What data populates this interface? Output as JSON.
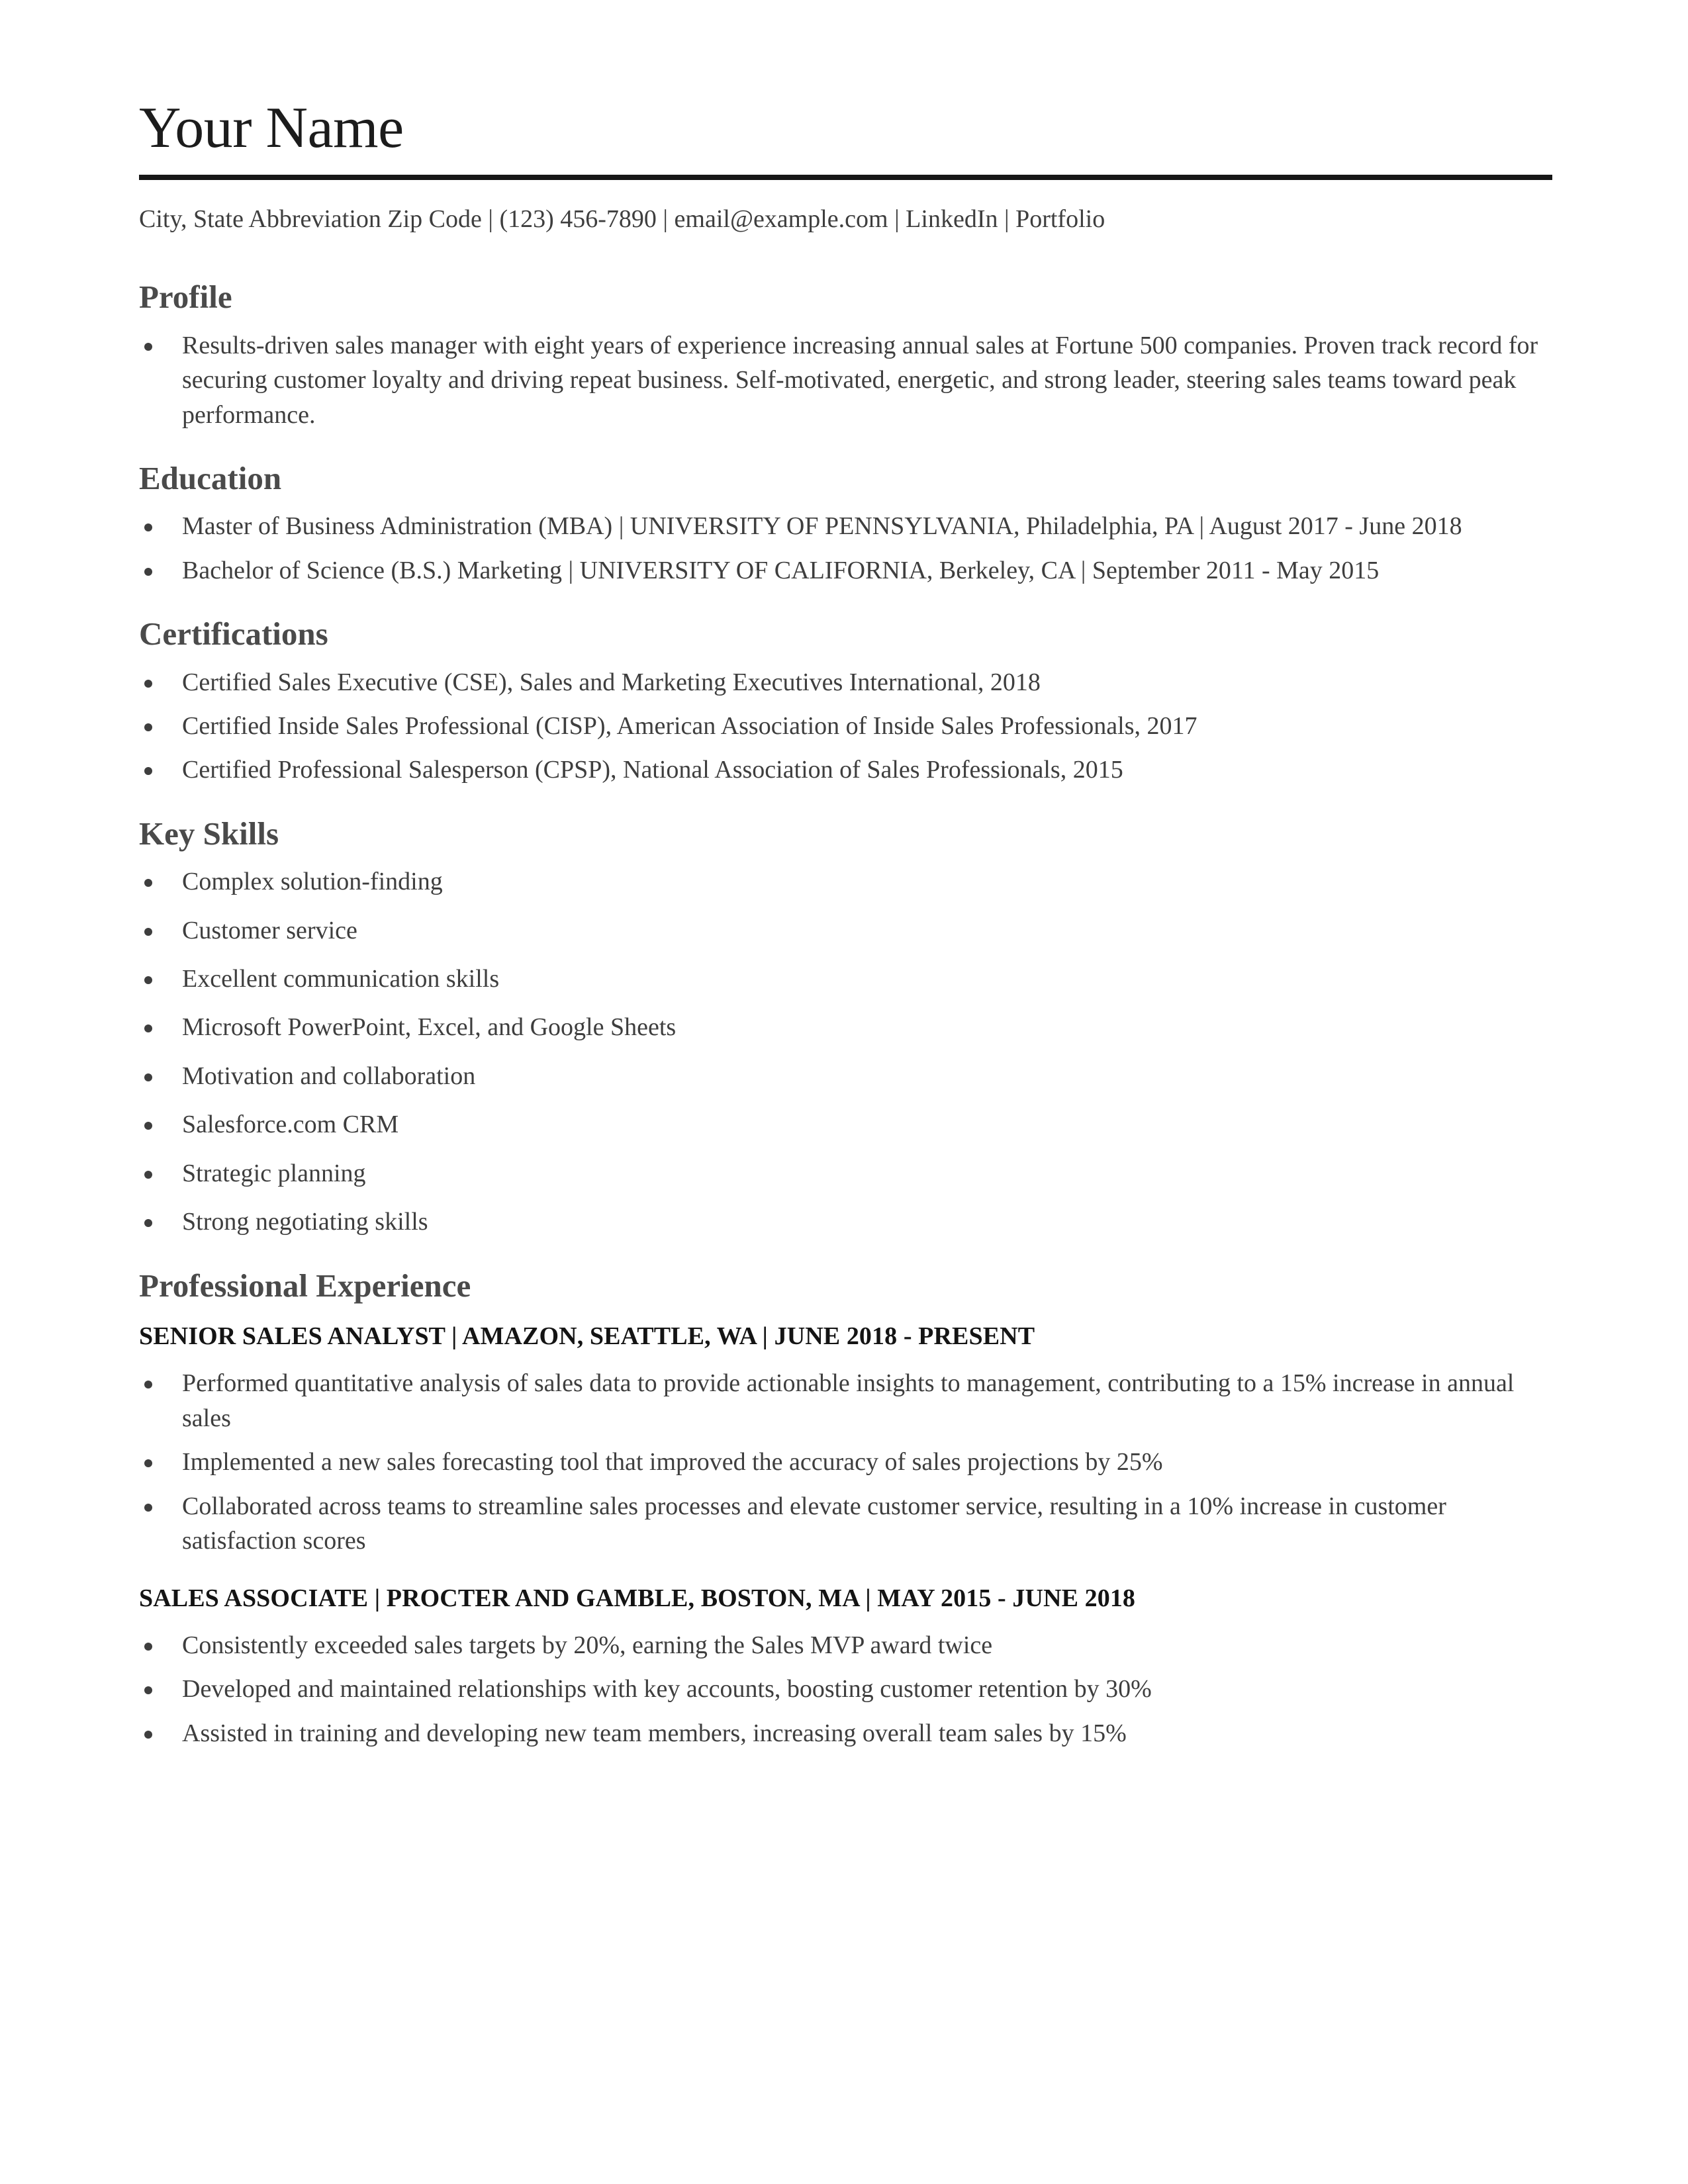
{
  "header": {
    "name": "Your Name",
    "contact": "City, State Abbreviation Zip Code | (123) 456-7890 | email@example.com | LinkedIn | Portfolio"
  },
  "profile": {
    "title": "Profile",
    "items": [
      "Results-driven sales manager with eight years of experience increasing annual sales at Fortune 500 companies. Proven track record for securing customer loyalty and driving repeat business. Self-motivated, energetic, and strong leader, steering sales teams toward peak performance."
    ]
  },
  "education": {
    "title": "Education",
    "items": [
      "Master of Business Administration (MBA) | UNIVERSITY OF PENNSYLVANIA, Philadelphia, PA | August 2017 - June 2018",
      "Bachelor of Science (B.S.) Marketing | UNIVERSITY OF CALIFORNIA, Berkeley, CA | September 2011 - May 2015"
    ]
  },
  "certifications": {
    "title": "Certifications",
    "items": [
      "Certified Sales Executive (CSE), Sales and Marketing Executives International, 2018",
      "Certified Inside Sales Professional (CISP), American Association of Inside Sales Professionals, 2017",
      "Certified Professional Salesperson (CPSP), National Association of Sales Professionals, 2015"
    ]
  },
  "key_skills": {
    "title": "Key Skills",
    "items": [
      "Complex solution-finding",
      "Customer service",
      "Excellent communication skills",
      "Microsoft PowerPoint, Excel, and Google Sheets",
      "Motivation and collaboration",
      "Salesforce.com CRM",
      "Strategic planning",
      "Strong negotiating skills"
    ]
  },
  "experience": {
    "title": "Professional Experience",
    "jobs": [
      {
        "heading": "SENIOR SALES ANALYST | AMAZON, SEATTLE, WA | JUNE 2018 - PRESENT",
        "bullets": [
          "Performed quantitative analysis of sales data to provide actionable insights to management, contributing to a 15% increase in annual sales",
          "Implemented a new sales forecasting tool that improved the accuracy of sales projections by 25%",
          "Collaborated across teams to streamline sales processes and elevate customer service, resulting in a 10% increase in customer satisfaction scores"
        ]
      },
      {
        "heading": "SALES ASSOCIATE | PROCTER AND GAMBLE, BOSTON, MA | MAY 2015 - JUNE 2018",
        "bullets": [
          "Consistently exceeded sales targets by 20%, earning the Sales MVP award twice",
          "Developed and maintained relationships with key accounts, boosting customer retention by 30%",
          "Assisted in training and developing new team members, increasing overall team sales by 15%"
        ]
      }
    ]
  },
  "colors": {
    "name_text": "#1c1c1c",
    "rule": "#171717",
    "heading": "#4a4a4a",
    "body": "#3e3e3e",
    "job_heading": "#141414",
    "background": "#ffffff"
  }
}
